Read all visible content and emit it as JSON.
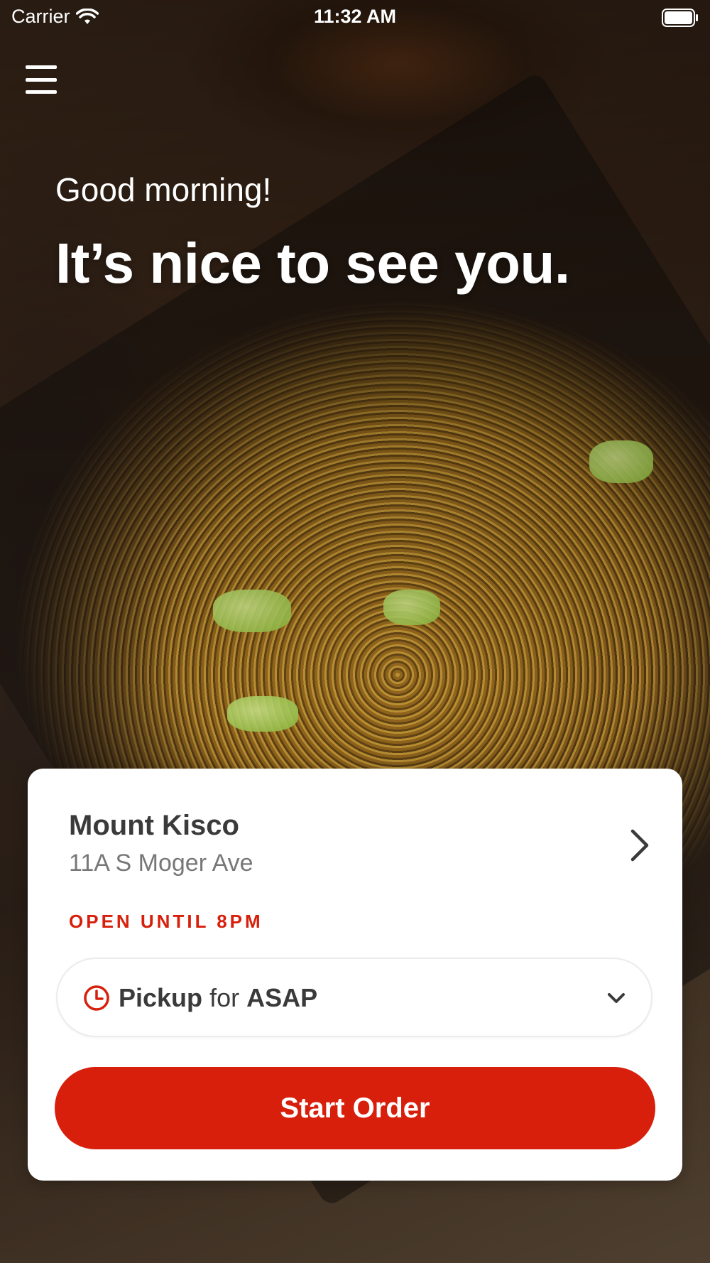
{
  "status_bar": {
    "carrier": "Carrier",
    "time": "11:32 AM",
    "wifi_icon": "wifi-icon",
    "battery_icon": "battery-full-icon"
  },
  "header": {
    "menu_icon": "hamburger-menu-icon"
  },
  "hero": {
    "greeting": "Good morning!",
    "headline": "It’s nice to see you."
  },
  "store_card": {
    "name": "Mount Kisco",
    "address": "11A S Moger Ave",
    "hours": "OPEN UNTIL 8PM",
    "chevron_icon": "chevron-right-icon",
    "order_mode": {
      "icon": "clock-icon",
      "mode": "Pickup",
      "connector": "for",
      "time": "ASAP",
      "dropdown_icon": "chevron-down-icon"
    },
    "start_order_label": "Start Order"
  },
  "colors": {
    "accent": "#d71f0b",
    "card_background": "#ffffff",
    "text_dark": "#3a3a3a",
    "text_muted": "#777777"
  }
}
